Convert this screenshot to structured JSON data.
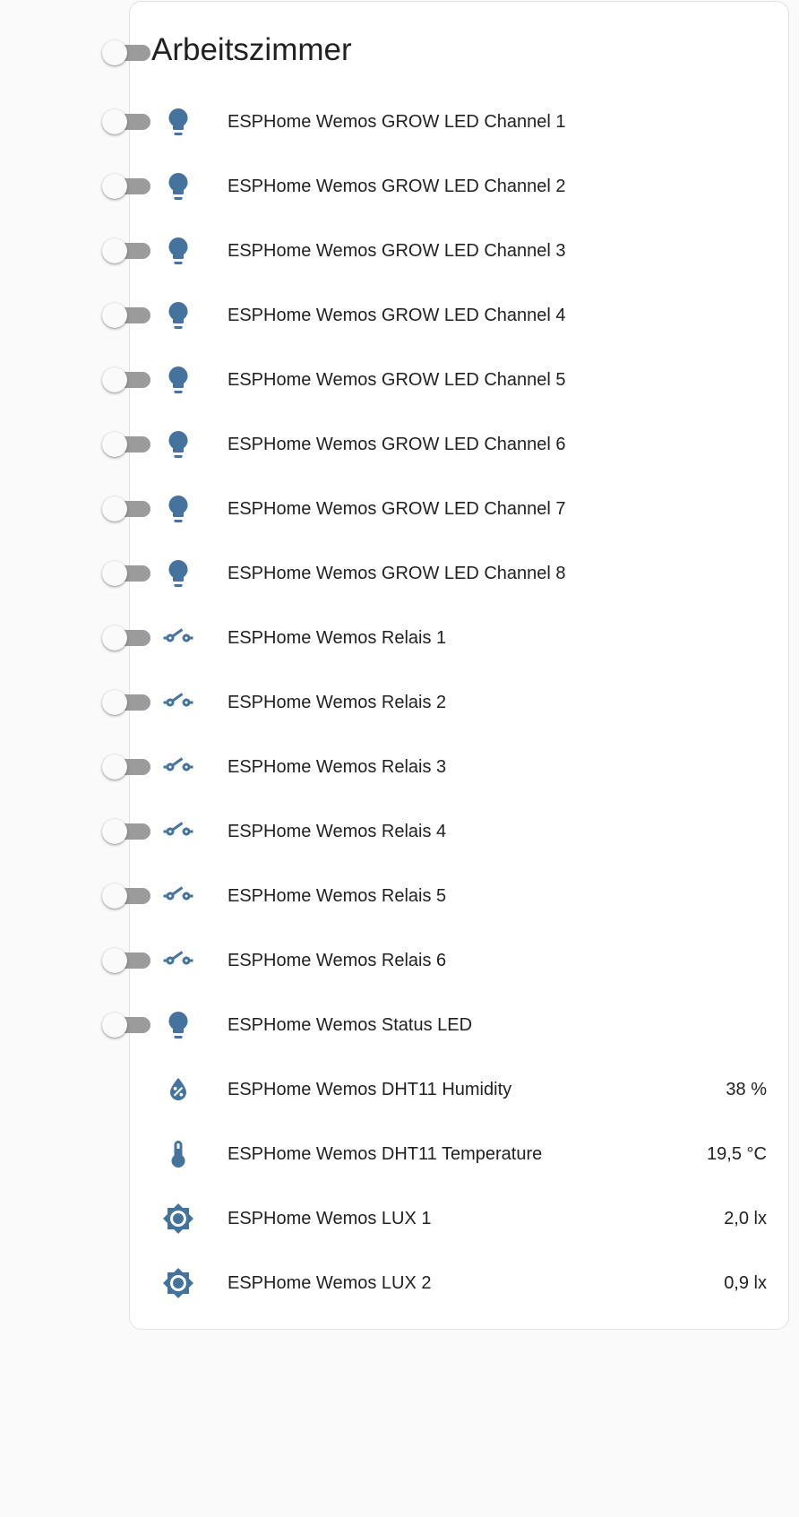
{
  "colors": {
    "icon": "#44739e",
    "toggle_track_off": "#9b9b9b",
    "toggle_thumb_off": "#fafafa",
    "card_background": "#ffffff",
    "page_background": "#fafafa"
  },
  "card": {
    "title": "Arbeitszimmer",
    "header_toggle_on": false
  },
  "entities": [
    {
      "icon": "lightbulb-icon",
      "name": "ESPHome Wemos GROW LED Channel 1",
      "control": "toggle",
      "on": false
    },
    {
      "icon": "lightbulb-icon",
      "name": "ESPHome Wemos GROW LED Channel 2",
      "control": "toggle",
      "on": false
    },
    {
      "icon": "lightbulb-icon",
      "name": "ESPHome Wemos GROW LED Channel 3",
      "control": "toggle",
      "on": false
    },
    {
      "icon": "lightbulb-icon",
      "name": "ESPHome Wemos GROW LED Channel 4",
      "control": "toggle",
      "on": false
    },
    {
      "icon": "lightbulb-icon",
      "name": "ESPHome Wemos GROW LED Channel 5",
      "control": "toggle",
      "on": false
    },
    {
      "icon": "lightbulb-icon",
      "name": "ESPHome Wemos GROW LED Channel 6",
      "control": "toggle",
      "on": false
    },
    {
      "icon": "lightbulb-icon",
      "name": "ESPHome Wemos GROW LED Channel 7",
      "control": "toggle",
      "on": false
    },
    {
      "icon": "lightbulb-icon",
      "name": "ESPHome Wemos GROW LED Channel 8",
      "control": "toggle",
      "on": false
    },
    {
      "icon": "electric-switch-icon",
      "name": "ESPHome Wemos Relais 1",
      "control": "toggle",
      "on": false
    },
    {
      "icon": "electric-switch-icon",
      "name": "ESPHome Wemos Relais 2",
      "control": "toggle",
      "on": false
    },
    {
      "icon": "electric-switch-icon",
      "name": "ESPHome Wemos Relais 3",
      "control": "toggle",
      "on": false
    },
    {
      "icon": "electric-switch-icon",
      "name": "ESPHome Wemos Relais 4",
      "control": "toggle",
      "on": false
    },
    {
      "icon": "electric-switch-icon",
      "name": "ESPHome Wemos Relais 5",
      "control": "toggle",
      "on": false
    },
    {
      "icon": "electric-switch-icon",
      "name": "ESPHome Wemos Relais 6",
      "control": "toggle",
      "on": false
    },
    {
      "icon": "lightbulb-icon",
      "name": "ESPHome Wemos Status LED",
      "control": "toggle",
      "on": false
    },
    {
      "icon": "water-percent-icon",
      "name": "ESPHome Wemos DHT11 Humidity",
      "control": "state",
      "state": "38 %"
    },
    {
      "icon": "thermometer-icon",
      "name": "ESPHome Wemos DHT11 Temperature",
      "control": "state",
      "state": "19,5 °C"
    },
    {
      "icon": "brightness-icon",
      "name": "ESPHome Wemos LUX 1",
      "control": "state",
      "state": "2,0 lx"
    },
    {
      "icon": "brightness-icon",
      "name": "ESPHome Wemos LUX 2",
      "control": "state",
      "state": "0,9 lx"
    }
  ]
}
